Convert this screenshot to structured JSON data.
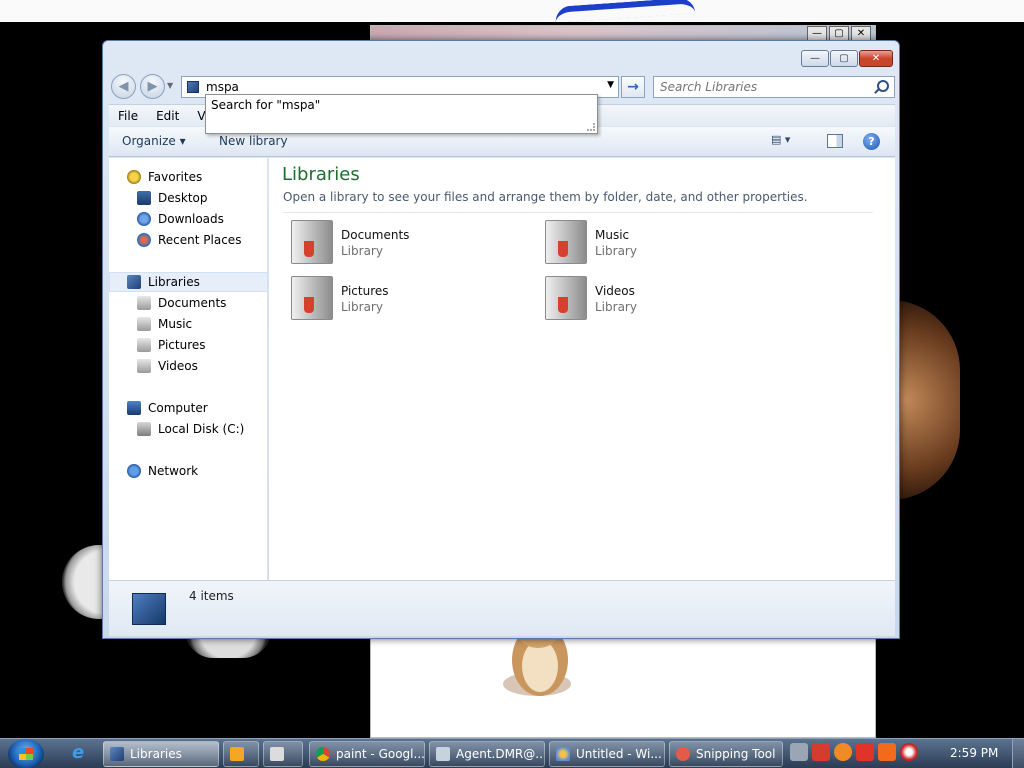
{
  "window": {
    "title": "Libraries",
    "controls": {
      "minimize": "—",
      "maximize": "▢",
      "close": "✕"
    }
  },
  "navigation": {
    "back": "◀",
    "forward": "▶",
    "address_value": "mspa",
    "search_placeholder": "Search Libraries",
    "go_glyph": "→"
  },
  "autocomplete": {
    "items": [
      "Search for \"mspa\""
    ]
  },
  "menu": {
    "items": [
      "File",
      "Edit",
      "Vie"
    ]
  },
  "toolbar": {
    "organize": "Organize ▾",
    "new_library": "New library",
    "views": "▤ ▾",
    "help": "?"
  },
  "sidebar": {
    "favorites": {
      "label": "Favorites",
      "items": [
        "Desktop",
        "Downloads",
        "Recent Places"
      ]
    },
    "libraries": {
      "label": "Libraries",
      "items": [
        "Documents",
        "Music",
        "Pictures",
        "Videos"
      ]
    },
    "computer": {
      "label": "Computer",
      "items": [
        "Local Disk (C:)"
      ]
    },
    "network": {
      "label": "Network"
    }
  },
  "main": {
    "title": "Libraries",
    "subtitle": "Open a library to see your files and arrange them by folder, date, and other properties.",
    "libraries": [
      {
        "name": "Documents",
        "type": "Library"
      },
      {
        "name": "Music",
        "type": "Library"
      },
      {
        "name": "Pictures",
        "type": "Library"
      },
      {
        "name": "Videos",
        "type": "Library"
      }
    ]
  },
  "details": {
    "count": "4 items"
  },
  "taskbar": {
    "items": [
      "Libraries",
      "paint - Googl...",
      "Agent.DMR@...",
      "Untitled - Wi...",
      "Snipping Tool"
    ],
    "clock": "2:59 PM"
  }
}
